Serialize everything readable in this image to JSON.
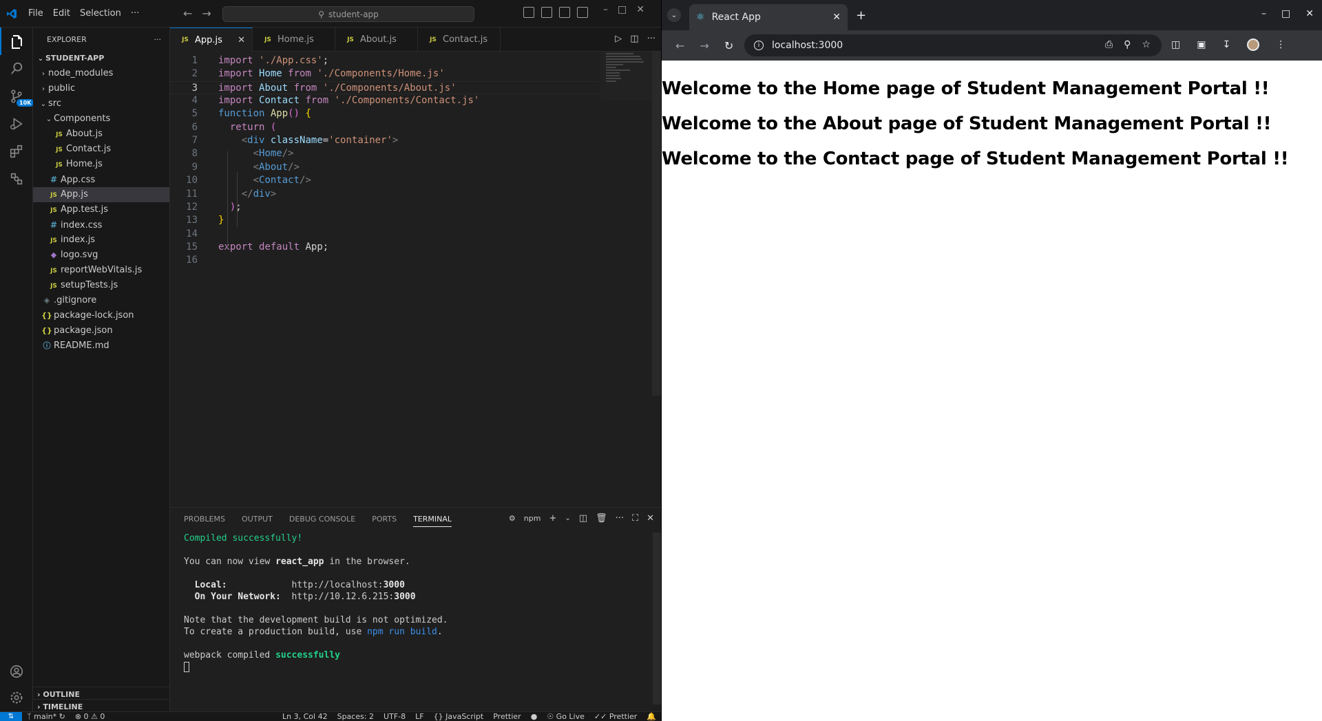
{
  "vscode": {
    "menu": [
      "File",
      "Edit",
      "Selection",
      "···"
    ],
    "search_text": "student-app",
    "explorer": {
      "title": "EXPLORER",
      "project": "STUDENT-APP",
      "items": [
        {
          "label": "node_modules",
          "type": "folder",
          "depth": 1,
          "open": false
        },
        {
          "label": "public",
          "type": "folder",
          "depth": 1,
          "open": false
        },
        {
          "label": "src",
          "type": "folder",
          "depth": 1,
          "open": true
        },
        {
          "label": "Components",
          "type": "folder",
          "depth": 2,
          "open": true
        },
        {
          "label": "About.js",
          "type": "js",
          "depth": 3
        },
        {
          "label": "Contact.js",
          "type": "js",
          "depth": 3
        },
        {
          "label": "Home.js",
          "type": "js",
          "depth": 3
        },
        {
          "label": "App.css",
          "type": "css",
          "depth": 2
        },
        {
          "label": "App.js",
          "type": "js",
          "depth": 2,
          "selected": true
        },
        {
          "label": "App.test.js",
          "type": "js",
          "depth": 2
        },
        {
          "label": "index.css",
          "type": "css",
          "depth": 2
        },
        {
          "label": "index.js",
          "type": "js",
          "depth": 2
        },
        {
          "label": "logo.svg",
          "type": "svg",
          "depth": 2
        },
        {
          "label": "reportWebVitals.js",
          "type": "js",
          "depth": 2
        },
        {
          "label": "setupTests.js",
          "type": "js",
          "depth": 2
        },
        {
          "label": ".gitignore",
          "type": "git",
          "depth": 1
        },
        {
          "label": "package-lock.json",
          "type": "json",
          "depth": 1
        },
        {
          "label": "package.json",
          "type": "json",
          "depth": 1
        },
        {
          "label": "README.md",
          "type": "info",
          "depth": 1
        }
      ],
      "outline": "OUTLINE",
      "timeline": "TIMELINE"
    },
    "source_control_badge": "10K",
    "tabs": [
      {
        "label": "App.js",
        "active": true
      },
      {
        "label": "Home.js",
        "active": false
      },
      {
        "label": "About.js",
        "active": false
      },
      {
        "label": "Contact.js",
        "active": false
      }
    ],
    "code_lines": [
      "import './App.css';",
      "import Home from './Components/Home.js'",
      "import About from './Components/About.js'",
      "import Contact from './Components/Contact.js'",
      "function App() {",
      "  return (",
      "    <div className='container'>",
      "      <Home/>",
      "      <About/>",
      "      <Contact/>",
      "    </div>",
      "  );",
      "}",
      "",
      "export default App;",
      ""
    ],
    "current_line": 3,
    "panel": {
      "tabs": [
        "PROBLEMS",
        "OUTPUT",
        "DEBUG CONSOLE",
        "PORTS",
        "TERMINAL"
      ],
      "active_tab": "TERMINAL",
      "shell": "npm"
    },
    "terminal": {
      "compiled": "Compiled successfully!",
      "view_prefix": "You can now view ",
      "app_name": "react_app",
      "view_suffix": " in the browser.",
      "local_label": "Local:",
      "local_url_prefix": "http://localhost:",
      "local_port": "3000",
      "network_label": "On Your Network:",
      "network_url_prefix": "http://10.12.6.215:",
      "network_port": "3000",
      "note1": "Note that the development build is not optimized.",
      "note2_prefix": "To create a production build, use ",
      "note2_cmd": "npm run build",
      "note2_suffix": ".",
      "webpack_prefix": "webpack compiled ",
      "webpack_status": "successfully"
    },
    "status": {
      "branch": "main*",
      "errors": "0",
      "warnings": "0",
      "position": "Ln 3, Col 42",
      "spaces": "Spaces: 2",
      "encoding": "UTF-8",
      "eol": "LF",
      "language": "JavaScript",
      "formatter": "Prettier",
      "golive": "Go Live",
      "prettier": "Prettier"
    }
  },
  "browser": {
    "tab_title": "React App",
    "url": "localhost:3000",
    "headings": [
      "Welcome to the Home page of Student Management Portal !!",
      "Welcome to the About page of Student Management Portal !!",
      "Welcome to the Contact page of Student Management Portal !!"
    ]
  }
}
